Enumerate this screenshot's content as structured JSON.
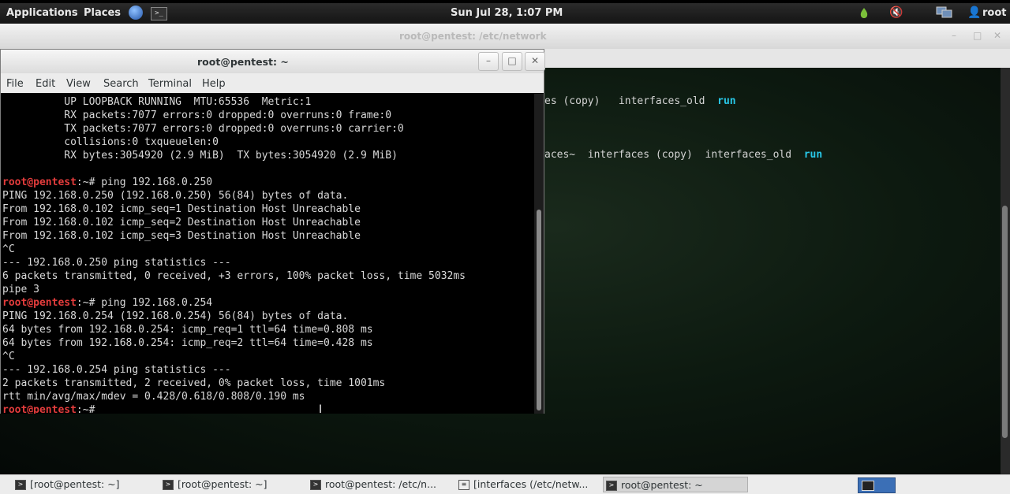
{
  "top_panel": {
    "applications": "Applications",
    "places": "Places",
    "clock": "Sun Jul 28,  1:07 PM",
    "user": "root"
  },
  "bg_window": {
    "title": "root@pentest: /etc/network",
    "line1": {
      "text": "es (copy)   interfaces_old  ",
      "run": "run"
    },
    "line2": {
      "text": "aces~  interfaces (copy)  interfaces_old  ",
      "run": "run"
    }
  },
  "front_window": {
    "title": "root@pentest: ~",
    "menu": [
      "File",
      "Edit",
      "View",
      "Search",
      "Terminal",
      "Help"
    ],
    "prompt": "root@pentest",
    "lines": [
      {
        "text": "          UP LOOPBACK RUNNING  MTU:65536  Metric:1"
      },
      {
        "text": "          RX packets:7077 errors:0 dropped:0 overruns:0 frame:0"
      },
      {
        "text": "          TX packets:7077 errors:0 dropped:0 overruns:0 carrier:0"
      },
      {
        "text": "          collisions:0 txqueuelen:0"
      },
      {
        "text": "          RX bytes:3054920 (2.9 MiB)  TX bytes:3054920 (2.9 MiB)"
      },
      {
        "text": ""
      },
      {
        "prompt": true,
        "text": ":~# ping 192.168.0.250"
      },
      {
        "text": "PING 192.168.0.250 (192.168.0.250) 56(84) bytes of data."
      },
      {
        "text": "From 192.168.0.102 icmp_seq=1 Destination Host Unreachable"
      },
      {
        "text": "From 192.168.0.102 icmp_seq=2 Destination Host Unreachable"
      },
      {
        "text": "From 192.168.0.102 icmp_seq=3 Destination Host Unreachable"
      },
      {
        "text": "^C"
      },
      {
        "text": "--- 192.168.0.250 ping statistics ---"
      },
      {
        "text": "6 packets transmitted, 0 received, +3 errors, 100% packet loss, time 5032ms"
      },
      {
        "text": "pipe 3"
      },
      {
        "prompt": true,
        "text": ":~# ping 192.168.0.254"
      },
      {
        "text": "PING 192.168.0.254 (192.168.0.254) 56(84) bytes of data."
      },
      {
        "text": "64 bytes from 192.168.0.254: icmp_req=1 ttl=64 time=0.808 ms"
      },
      {
        "text": "64 bytes from 192.168.0.254: icmp_req=2 ttl=64 time=0.428 ms"
      },
      {
        "text": "^C"
      },
      {
        "text": "--- 192.168.0.254 ping statistics ---"
      },
      {
        "text": "2 packets transmitted, 2 received, 0% packet loss, time 1001ms"
      },
      {
        "text": "rtt min/avg/max/mdev = 0.428/0.618/0.808/0.190 ms"
      },
      {
        "prompt": true,
        "text": ":~# "
      }
    ]
  },
  "taskbar": {
    "items": [
      {
        "label": "[root@pentest: ~]",
        "active": false
      },
      {
        "label": "[root@pentest: ~]",
        "active": false
      },
      {
        "label": "root@pentest: /etc/n...",
        "active": false
      },
      {
        "label": "[interfaces (/etc/netw...",
        "active": false
      },
      {
        "label": "root@pentest: ~",
        "active": true
      }
    ]
  },
  "colors": {
    "prompt": "#e33c3c",
    "directory": "#28c8e8",
    "terminal_bg": "#000000"
  }
}
